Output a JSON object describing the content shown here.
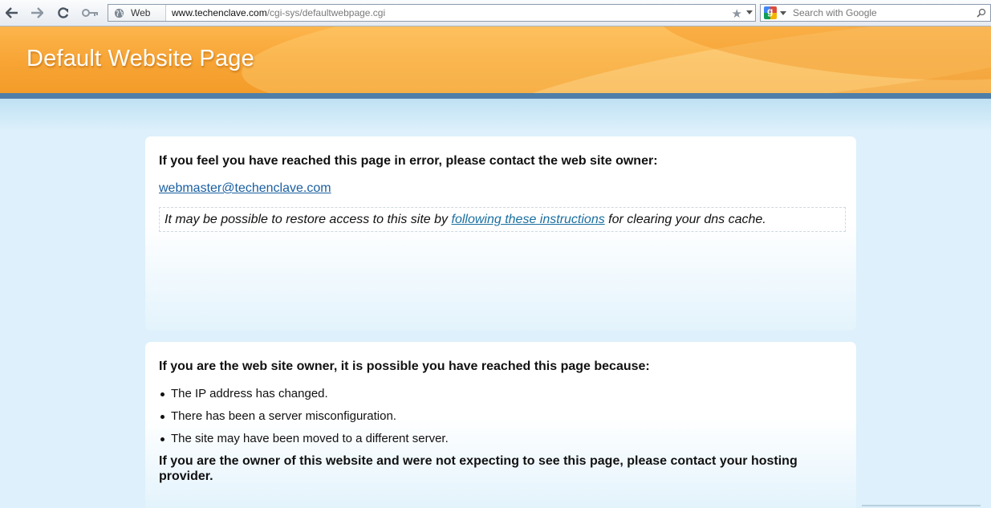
{
  "browser": {
    "back_icon": "arrow-left-icon",
    "forward_icon": "arrow-right-icon",
    "reload_icon": "reload-icon",
    "key_icon": "key-icon",
    "site_button": {
      "icon": "globe-icon",
      "label": "Web"
    },
    "url": {
      "host": "www.techenclave.com",
      "path": "/cgi-sys/defaultwebpage.cgi"
    },
    "bookmark_icon": "star-icon",
    "search": {
      "engine_icon": "google-icon",
      "placeholder": "Search with Google",
      "icon": "magnifier-icon"
    }
  },
  "banner": {
    "title": "Default Website Page"
  },
  "error_card": {
    "heading": "If you feel you have reached this page in error, please contact the web site owner:",
    "email": "webmaster@techenclave.com",
    "dns_prefix": "It may be possible to restore access to this site by ",
    "dns_link": "following these instructions",
    "dns_suffix": " for clearing your dns cache."
  },
  "owner_card": {
    "heading": "If you are the web site owner, it is possible you have reached this page because:",
    "reasons": [
      "The IP address has changed.",
      "There has been a server misconfiguration.",
      "The site may have been moved to a different server."
    ],
    "note": "If you are the owner of this website and were not expecting to see this page, please contact your hosting provider."
  },
  "colors": {
    "banner": "#f7a434",
    "accent_bar": "#4f7ea8",
    "link": "#1a5fa0",
    "background": "#ddf0fb"
  }
}
